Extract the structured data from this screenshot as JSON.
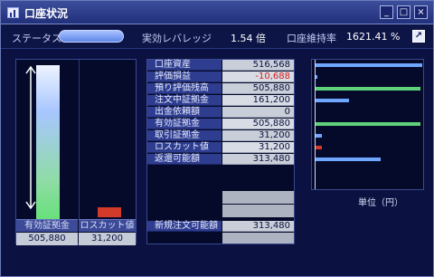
{
  "window": {
    "title": "口座状況",
    "buttons": {
      "minimize": "_",
      "maximize": "□",
      "close": "×"
    }
  },
  "statusbar": {
    "status_label": "ステータス",
    "leverage_label": "実効レバレッジ",
    "leverage_value": "1.54 倍",
    "maintenance_label": "口座維持率",
    "maintenance_value": "1621.41 %",
    "popout_icon": "↗"
  },
  "left_chart": {
    "labels": [
      "有効証拠金",
      "ロスカット値"
    ],
    "values": [
      "505,880",
      "31,200"
    ],
    "levels_relative_to_margin": [
      1.0,
      0.062
    ],
    "colors": {
      "margin_top": "#eef3ff",
      "margin_bottom": "#68e07a",
      "losscut": "#d23a2a"
    }
  },
  "table": {
    "rows": [
      {
        "label": "口座資産",
        "value": "516,568"
      },
      {
        "label": "評価損益",
        "value": "-10,688",
        "negative": true
      },
      {
        "label": "預り評価残高",
        "value": "505,880"
      },
      {
        "label": "注文中証拠金",
        "value": "161,200"
      },
      {
        "label": "出金依頼額",
        "value": "0"
      },
      {
        "label": "有効証拠金",
        "value": "505,880"
      },
      {
        "label": "取引証拠金",
        "value": "31,200"
      },
      {
        "label": "ロスカット値",
        "value": "31,200"
      },
      {
        "label": "返還可能額",
        "value": "313,480"
      }
    ],
    "new_order_label": "新規注文可能額",
    "new_order_value": "313,480"
  },
  "right_chart": {
    "unit_label": "単位（円）",
    "bar_values": [
      516568,
      -10688,
      505880,
      161200,
      0,
      505880,
      31200,
      31200,
      313480
    ],
    "bar_max": 516568,
    "bar_colors": [
      "#6fa6ff",
      "#6fa6ff",
      "#5fd17a",
      "#6fa6ff",
      "#6fa6ff",
      "#5fd17a",
      "#6fa6ff",
      "#d23a2a",
      "#6fa6ff"
    ]
  }
}
